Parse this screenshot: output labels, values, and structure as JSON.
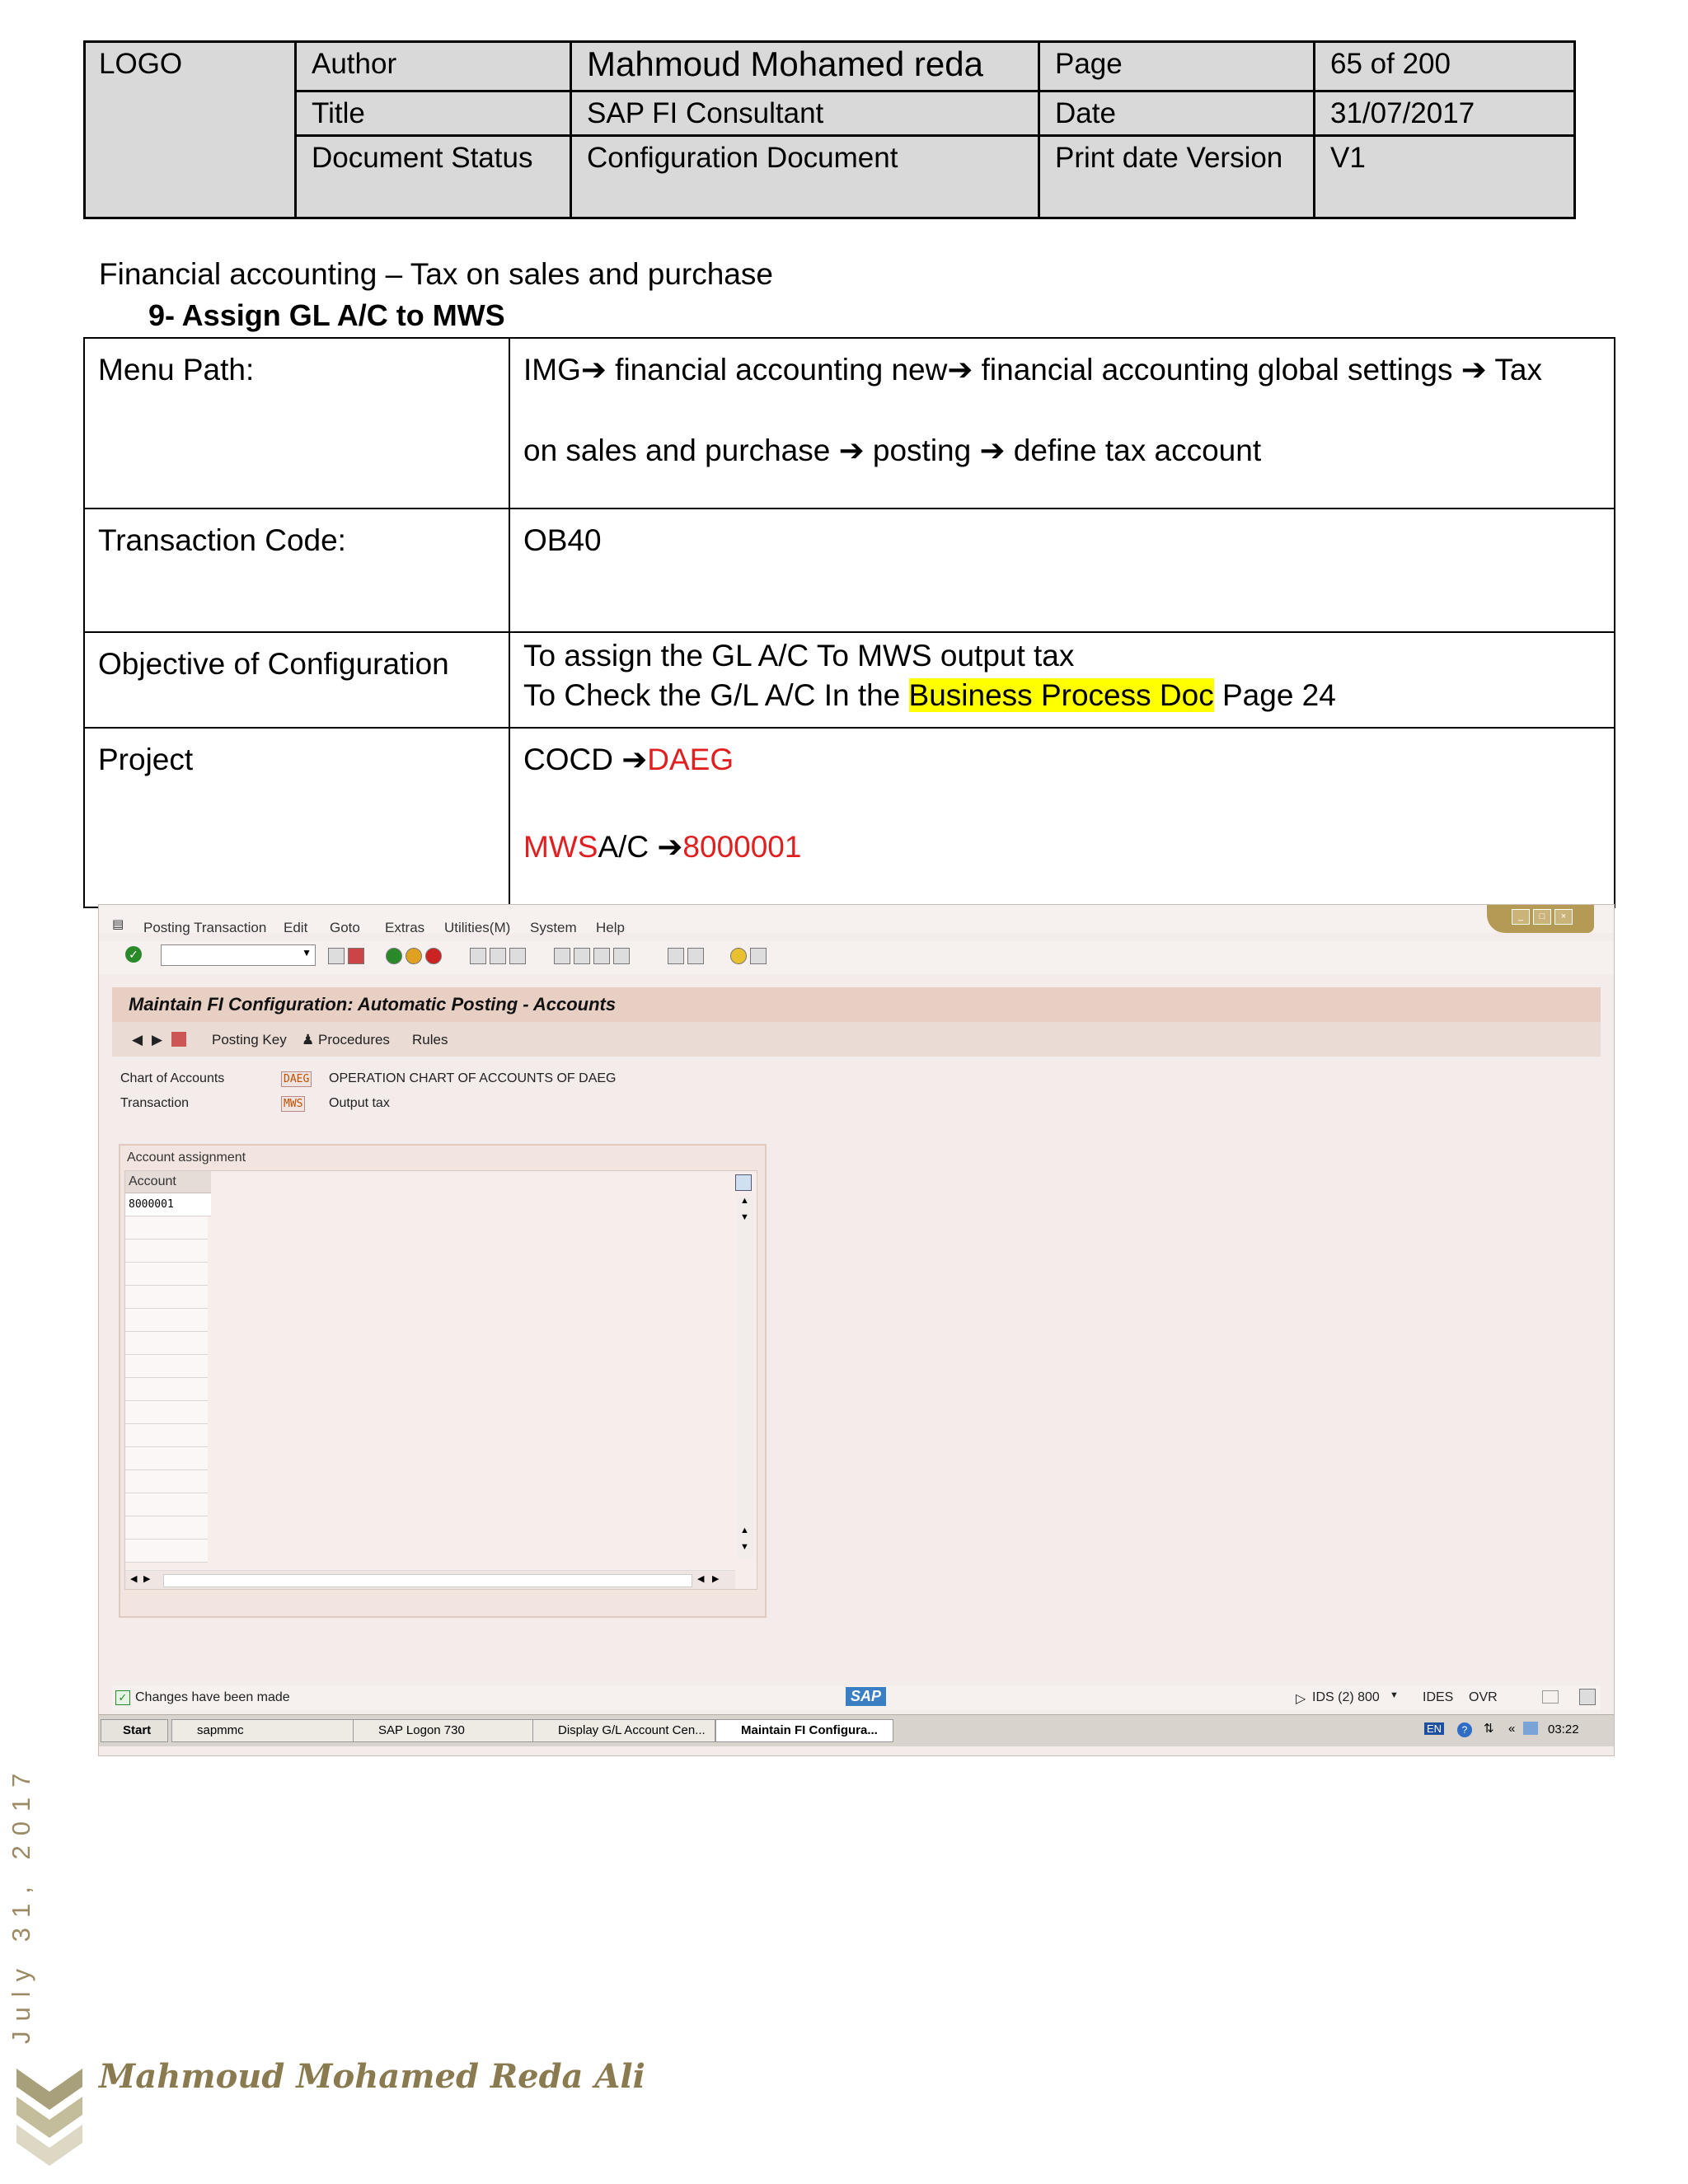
{
  "header": {
    "logo": "LOGO",
    "author_label": "Author",
    "author_value": "Mahmoud Mohamed reda",
    "page_label": "Page",
    "page_value": "65 of 200",
    "title_label": "Title",
    "title_value": "SAP FI Consultant",
    "date_label": "Date",
    "date_value": "31/07/2017",
    "status_label": "Document Status",
    "status_value": "Configuration Document",
    "print_label": "Print date Version",
    "print_value": "V1"
  },
  "section_title": "Financial accounting – Tax on sales and purchase",
  "step_title": "9-   Assign GL A/C to MWS",
  "config": {
    "menu_path_label": "Menu Path:",
    "menu_path": {
      "img": "IMG",
      "p1": " financial accounting new",
      "p2": " financial accounting global settings ",
      "p3": " Tax",
      "p4": "on sales and purchase ",
      "p5": " posting ",
      "p6": " define tax account"
    },
    "arrow": "➔",
    "tcode_label": "Transaction Code:",
    "tcode_value": "OB40",
    "objective_label": "Objective of Configuration",
    "objective_line1": "To assign the GL A/C To MWS output tax",
    "objective_line2_pre": "To Check the G/L A/C In the ",
    "objective_line2_hl": "Business Process Doc",
    "objective_line2_post": " Page 24",
    "project_label": "Project",
    "project_cocd_label": "COCD ",
    "project_cocd_value": "DAEG",
    "project_mws_red": "MWS",
    "project_mws_label": "A/C ",
    "project_mws_value": "8000001"
  },
  "sap": {
    "menu": [
      "Posting Transaction",
      "Edit",
      "Goto",
      "Extras",
      "Utilities(M)",
      "System",
      "Help"
    ],
    "screen_title": "Maintain FI Configuration: Automatic Posting - Accounts",
    "app_toolbar": {
      "posting_key": "Posting Key",
      "procedures": "Procedures",
      "rules": "Rules"
    },
    "chart_label": "Chart of Accounts",
    "chart_code": "DAEG",
    "chart_desc": "OPERATION CHART OF ACCOUNTS OF DAEG",
    "trans_label": "Transaction",
    "trans_code": "MWS",
    "trans_desc": "Output tax",
    "group_title": "Account assignment",
    "col_header": "Account",
    "account_value": "8000001",
    "status_msg": "Changes have been made",
    "sap_logo": "SAP",
    "system_info": "IDS (2) 800",
    "server": "IDES",
    "mode": "OVR",
    "taskbar": {
      "start": "Start",
      "t1": "sapmmc",
      "t2": "SAP Logon 730",
      "t3": "Display G/L Account Cen...",
      "t4": "Maintain FI Configura...",
      "lang": "EN",
      "clock": "03:22"
    }
  },
  "side_date": "July 31, 2017",
  "footer_name": "Mahmoud Mohamed Reda Ali",
  "colors": {
    "red": "#e02020",
    "highlight": "#ffff00",
    "header_bg": "#d9d9d9",
    "footer_gold": "#8a7a50"
  }
}
